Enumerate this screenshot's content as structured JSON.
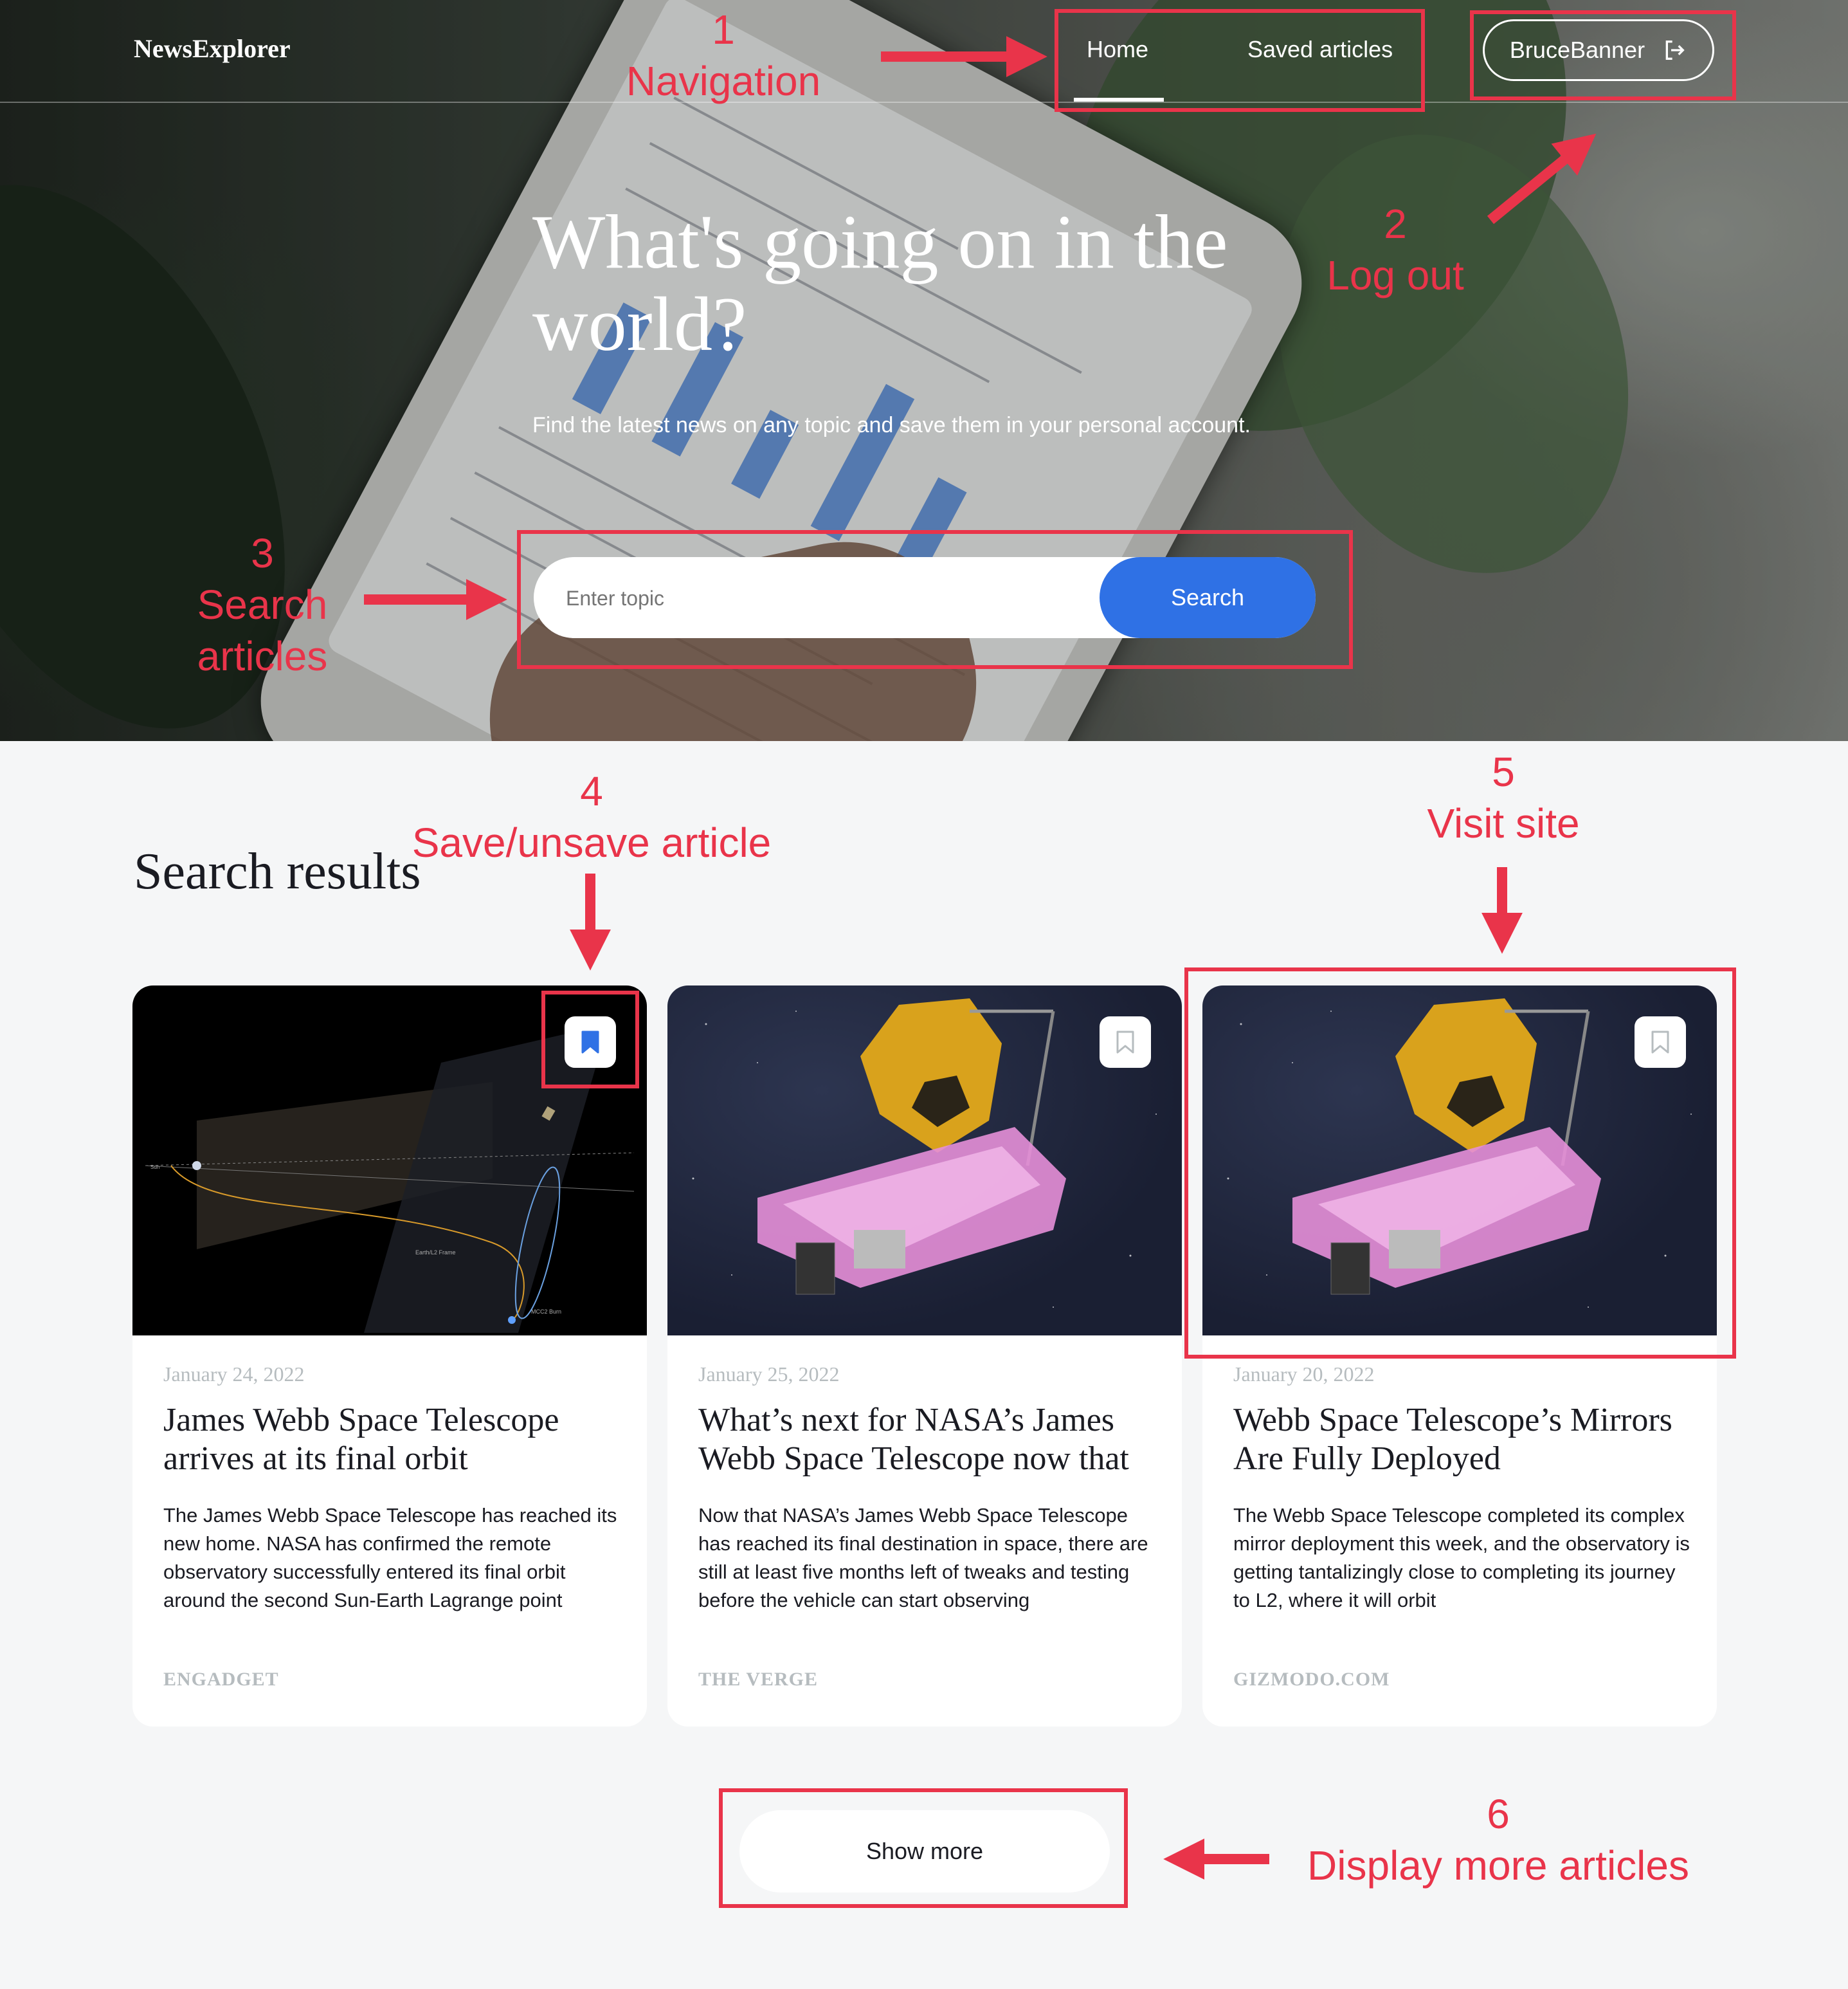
{
  "header": {
    "logo": "NewsExplorer",
    "nav": {
      "home": "Home",
      "saved": "Saved articles"
    },
    "user": {
      "name": "BruceBanner",
      "icon": "logout-icon"
    }
  },
  "hero": {
    "title": "What's going on in the world?",
    "subtitle": "Find the latest news on any topic and save them in your personal account.",
    "search": {
      "placeholder": "Enter topic",
      "button": "Search"
    }
  },
  "results": {
    "title": "Search results",
    "cards": [
      {
        "date": "January 24, 2022",
        "title": "James Webb Space Telescope arrives at its final orbit",
        "text": "The James Webb Space Telescope has reached its new home. NASA has confirmed the remote observatory successfully entered its final orbit around the second Sun-Earth Lagrange point",
        "source": "ENGADGET",
        "saved": true,
        "image_labels": {
          "frame": "Earth/L2 Frame",
          "burn": "MCC2 Burn",
          "sun": "Sun"
        }
      },
      {
        "date": "January 25, 2022",
        "title": "What’s next for NASA’s James Webb Space Telescope now that",
        "text": "Now that NASA’s James Webb Space Telescope has reached its final destination in space, there are still at least five months left of tweaks and testing before the vehicle can start observing",
        "source": "THE VERGE",
        "saved": false
      },
      {
        "date": "January 20, 2022",
        "title": "Webb Space Telescope’s Mirrors Are Fully Deployed",
        "text": "The Webb Space Telescope completed its complex mirror deployment this week, and the observatory is getting tantalizingly close to completing its journey to L2, where it will orbit",
        "source": "GIZMODO.COM",
        "saved": false
      }
    ],
    "show_more": "Show more"
  },
  "annotations": [
    {
      "number": "1",
      "label": "Navigation"
    },
    {
      "number": "2",
      "label": "Log out"
    },
    {
      "number": "3",
      "label": "Search articles"
    },
    {
      "number": "4",
      "label": "Save/unsave article"
    },
    {
      "number": "5",
      "label": "Visit site"
    },
    {
      "number": "6",
      "label": "Display more articles"
    }
  ],
  "colors": {
    "accent": "#2f71e5",
    "annotation": "#e9344a",
    "page_background": "#f5f6f7",
    "muted_text": "#b6bcbf"
  }
}
